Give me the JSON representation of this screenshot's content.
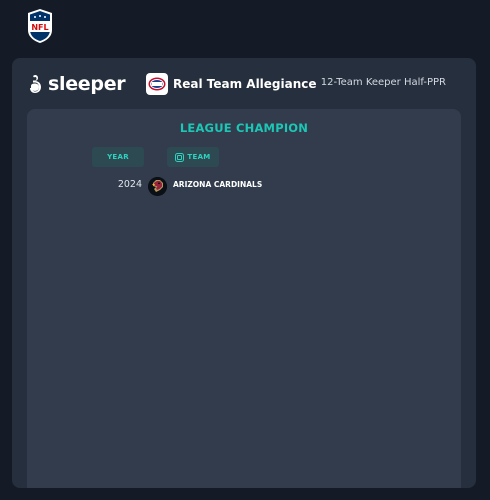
{
  "header": {
    "logo_icon": "nfl-shield-icon"
  },
  "card": {
    "brand": {
      "icon": "sleeper-logo-icon",
      "label": "sleeper"
    },
    "league": {
      "avatar_icon": "league-avatar-icon",
      "name": "Real Team Allegiance",
      "format": "12-Team Keeper Half-PPR"
    }
  },
  "panel": {
    "title": "LEAGUE CHAMPION",
    "columns": {
      "year": "YEAR",
      "team": "TEAM"
    },
    "rows": [
      {
        "year": "2024",
        "team_logo_icon": "arizona-cardinals-logo-icon",
        "team": "ARIZONA CARDINALS"
      }
    ]
  },
  "colors": {
    "accent": "#1cc7b6",
    "background": "#151b26",
    "card": "#262f3d",
    "panel": "#323c4c"
  }
}
